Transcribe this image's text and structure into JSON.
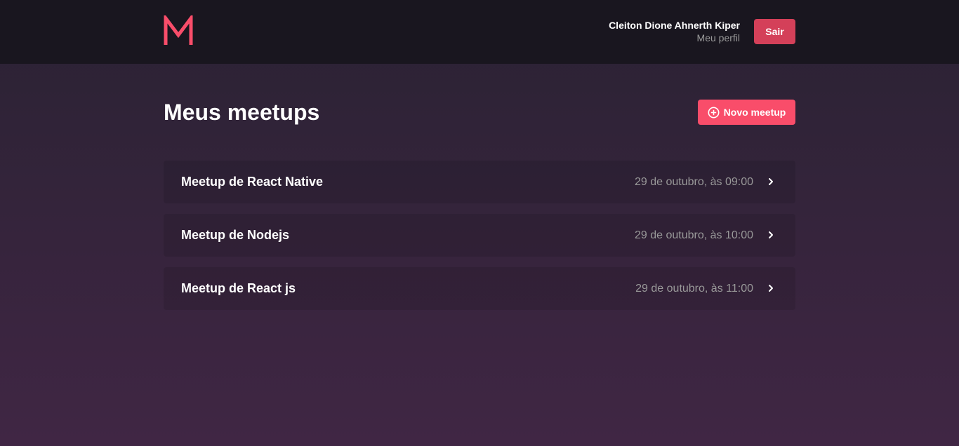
{
  "header": {
    "user_name": "Cleiton Dione Ahnerth Kiper",
    "profile_link": "Meu perfil",
    "logout_label": "Sair",
    "logo_icon": "m-logo-icon"
  },
  "main": {
    "title": "Meus meetups",
    "new_button_label": "Novo meetup",
    "new_button_icon": "plus-circle-icon",
    "meetups": [
      {
        "title": "Meetup de React Native",
        "date": "29 de outubro, às 09:00"
      },
      {
        "title": "Meetup de Nodejs",
        "date": "29 de outubro, às 10:00"
      },
      {
        "title": "Meetup de React js",
        "date": "29 de outubro, às 11:00"
      }
    ]
  },
  "colors": {
    "accent": "#f94d6a",
    "logout": "#d44059",
    "header_bg": "#19161f",
    "bg_top": "#2a2233",
    "bg_bottom": "#402644",
    "muted_text": "#999999"
  }
}
